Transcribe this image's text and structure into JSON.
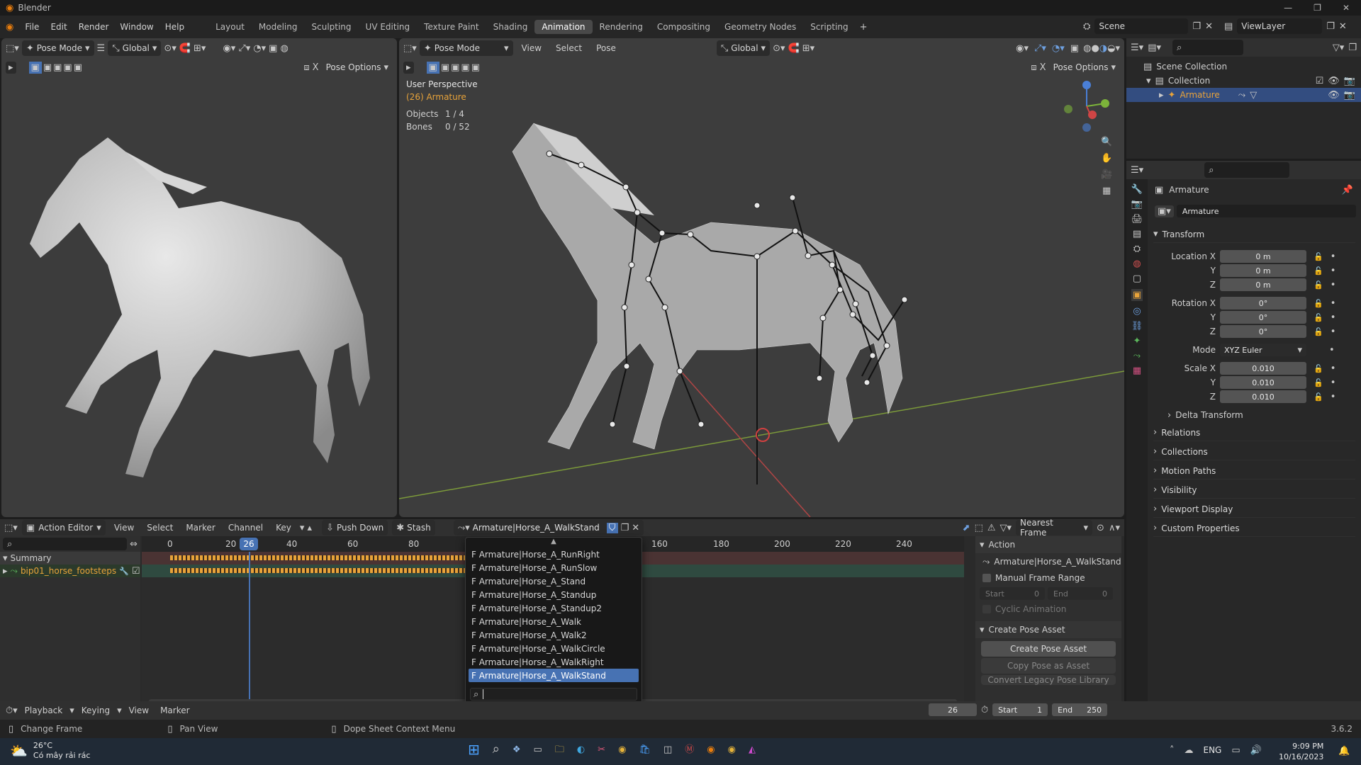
{
  "window": {
    "title": "Blender"
  },
  "menu": [
    "File",
    "Edit",
    "Render",
    "Window",
    "Help"
  ],
  "workspaces": [
    "Layout",
    "Modeling",
    "Sculpting",
    "UV Editing",
    "Texture Paint",
    "Shading",
    "Animation",
    "Rendering",
    "Compositing",
    "Geometry Nodes",
    "Scripting"
  ],
  "active_workspace": "Animation",
  "scene": "Scene",
  "viewlayer": "ViewLayer",
  "left_viewport": {
    "mode": "Pose Mode",
    "orientation": "Global",
    "pose_options": "Pose Options"
  },
  "main_viewport": {
    "mode": "Pose Mode",
    "orientation": "Global",
    "menus": [
      "View",
      "Select",
      "Pose"
    ],
    "pose_options": "Pose Options",
    "overlay_title": "User Perspective",
    "overlay_object": "(26) Armature",
    "stats": [
      {
        "label": "Objects",
        "value": "1 / 4"
      },
      {
        "label": "Bones",
        "value": "0 / 52"
      }
    ]
  },
  "outliner": {
    "root": "Scene Collection",
    "collection": "Collection",
    "object": "Armature"
  },
  "properties": {
    "object_header": "Armature",
    "object_name": "Armature",
    "transform": "Transform",
    "location_label": "Location X",
    "rotation_label": "Rotation X",
    "scale_label": "Scale X",
    "axis_y": "Y",
    "axis_z": "Z",
    "location": [
      "0 m",
      "0 m",
      "0 m"
    ],
    "rotation": [
      "0°",
      "0°",
      "0°"
    ],
    "mode_label": "Mode",
    "mode_value": "XYZ Euler",
    "scale": [
      "0.010",
      "0.010",
      "0.010"
    ],
    "delta": "Delta Transform",
    "panels": [
      "Relations",
      "Collections",
      "Motion Paths",
      "Visibility",
      "Viewport Display",
      "Custom Properties"
    ]
  },
  "dopesheet": {
    "editor": "Action Editor",
    "menus": [
      "View",
      "Select",
      "Marker",
      "Channel",
      "Key"
    ],
    "push_down": "Push Down",
    "stash": "Stash",
    "action": "Armature|Horse_A_WalkStand",
    "snap": "Nearest Frame",
    "ruler": [
      "0",
      "20",
      "40",
      "60",
      "80",
      "160",
      "180",
      "200",
      "220",
      "240"
    ],
    "current_frame": "26",
    "channels": [
      "Summary",
      "bip01_horse_footsteps"
    ],
    "side_action_header": "Action",
    "side_action_name": "Armature|Horse_A_WalkStand",
    "manual_frame_range": "Manual Frame Range",
    "start_label": "Start",
    "start_value": "0",
    "end_label": "End",
    "end_value": "0",
    "cyclic": "Cyclic Animation",
    "pose_asset_header": "Create Pose Asset",
    "create_pose_asset": "Create Pose Asset",
    "copy_pose": "Copy Pose as Asset",
    "convert_legacy": "Convert Legacy Pose Library"
  },
  "dropdown_items": [
    "F Armature|Horse_A_RunRight",
    "F Armature|Horse_A_RunSlow",
    "F Armature|Horse_A_Stand",
    "F Armature|Horse_A_Standup",
    "F Armature|Horse_A_Standup2",
    "F Armature|Horse_A_Walk",
    "F Armature|Horse_A_Walk2",
    "F Armature|Horse_A_WalkCircle",
    "F Armature|Horse_A_WalkRight",
    "F Armature|Horse_A_WalkStand"
  ],
  "timeline": {
    "menus": [
      "Playback",
      "Keying",
      "View",
      "Marker"
    ],
    "frame": "26",
    "start_label": "Start",
    "start": "1",
    "end_label": "End",
    "end": "250"
  },
  "status": {
    "left": "Change Frame",
    "middle": "Pan View",
    "right": "Dope Sheet Context Menu",
    "version": "3.6.2"
  },
  "taskbar": {
    "weather_temp": "26°C",
    "weather_text": "Có mây rải rác",
    "lang": "ENG",
    "time": "9:09 PM",
    "date": "10/16/2023"
  }
}
